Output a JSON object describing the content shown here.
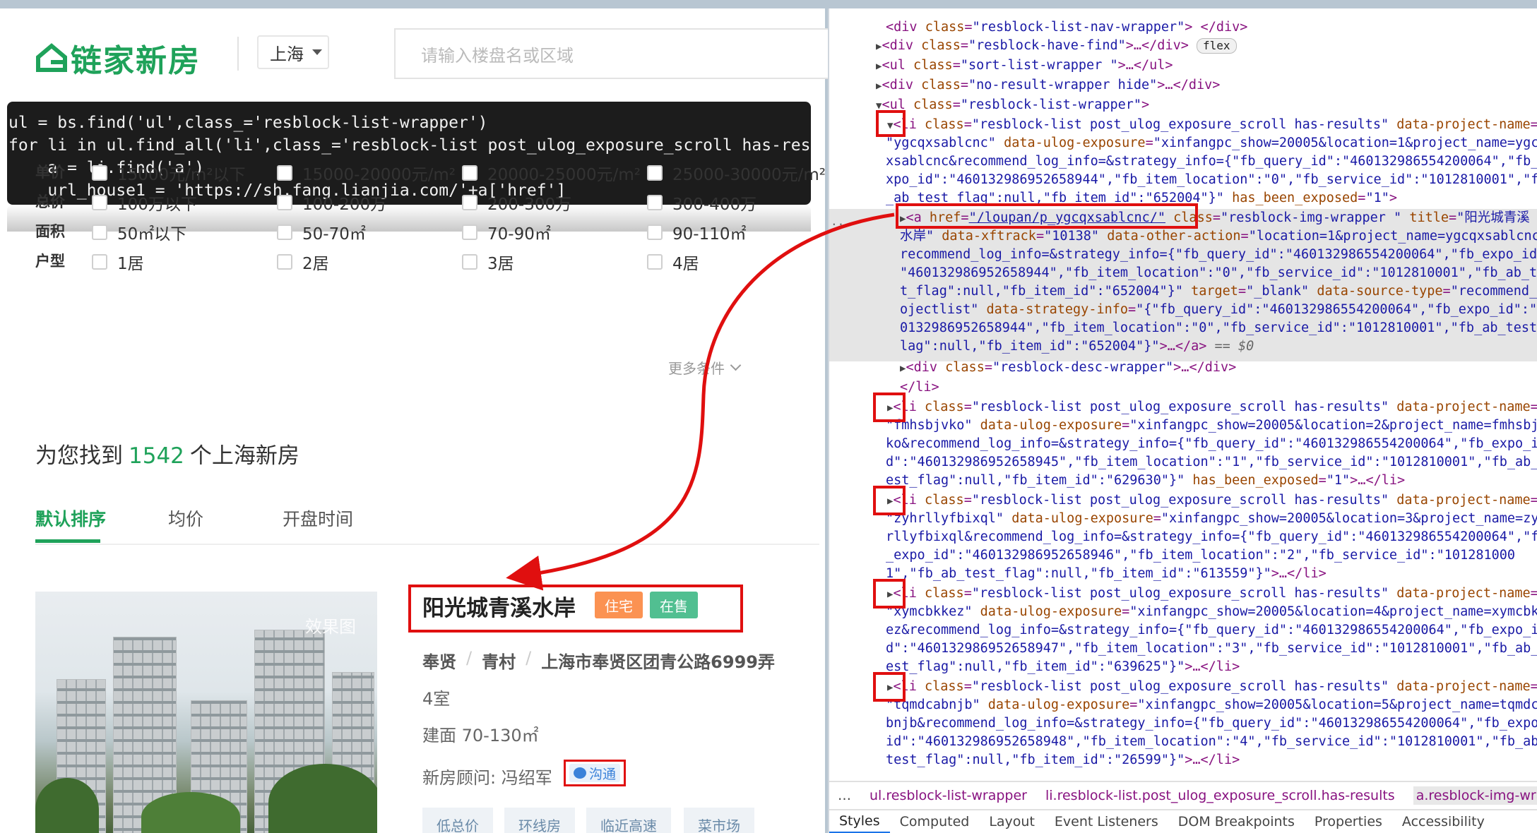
{
  "site": {
    "logo_text": "链家新房",
    "city": "上海",
    "search_placeholder": "请输入楼盘名或区域",
    "code_lines": [
      "ul = bs.find('ul',class_='resblock-list-wrapper')",
      "for li in ul.find_all('li',class_='resblock-list post_ulog_exposure_scroll has-results'):",
      "    a = li.find('a')",
      "    url_house1 = 'https://sh.fang.lianjia.com/'+a['href']"
    ],
    "filters": [
      {
        "label": "单价",
        "options": [
          "15000元/m²以下",
          "15000-20000元/m²",
          "20000-25000元/m²",
          "25000-30000元/m²"
        ]
      },
      {
        "label": "总价",
        "options": [
          "100万以下",
          "100-200万",
          "200-300万",
          "300-400万"
        ]
      },
      {
        "label": "面积",
        "options": [
          "50㎡以下",
          "50-70㎡",
          "70-90㎡",
          "90-110㎡"
        ]
      },
      {
        "label": "户型",
        "options": [
          "1居",
          "2居",
          "3居",
          "4居"
        ]
      }
    ],
    "more_conditions": "更多条件",
    "found_prefix": "为您找到",
    "found_count": "1542",
    "found_suffix": "个上海新房",
    "sort_tabs": [
      "默认排序",
      "均价",
      "开盘时间"
    ],
    "listing": {
      "title": "阳光城青溪水岸",
      "tag_type": "住宅",
      "tag_status": "在售",
      "district": "奉贤",
      "area_name": "青村",
      "address": "上海市奉贤区团青公路6999弄",
      "rooms": "4室",
      "built_area": "建面 70-130㎡",
      "advisor": "新房顾问: 冯绍军",
      "chat_label": "沟通",
      "photo_watermark": "效果图",
      "tags": [
        "低总价",
        "环线房",
        "临近高速",
        "菜市场"
      ]
    }
  },
  "devtools": {
    "crumbs": [
      "ul.resblock-list-wrapper",
      "li.resblock-list.post_ulog_exposure_scroll.has-results",
      "a.resblock-img-wrapper."
    ],
    "tabs": [
      "Styles",
      "Computed",
      "Layout",
      "Event Listeners",
      "DOM Breakpoints",
      "Properties",
      "Accessibility"
    ],
    "flex_badge": "flex"
  },
  "colors": {
    "brand_green": "#1fa25a",
    "highlight_red": "#e00f0f",
    "tag_orange": "#fb9252",
    "tag_green": "#51bf91"
  }
}
